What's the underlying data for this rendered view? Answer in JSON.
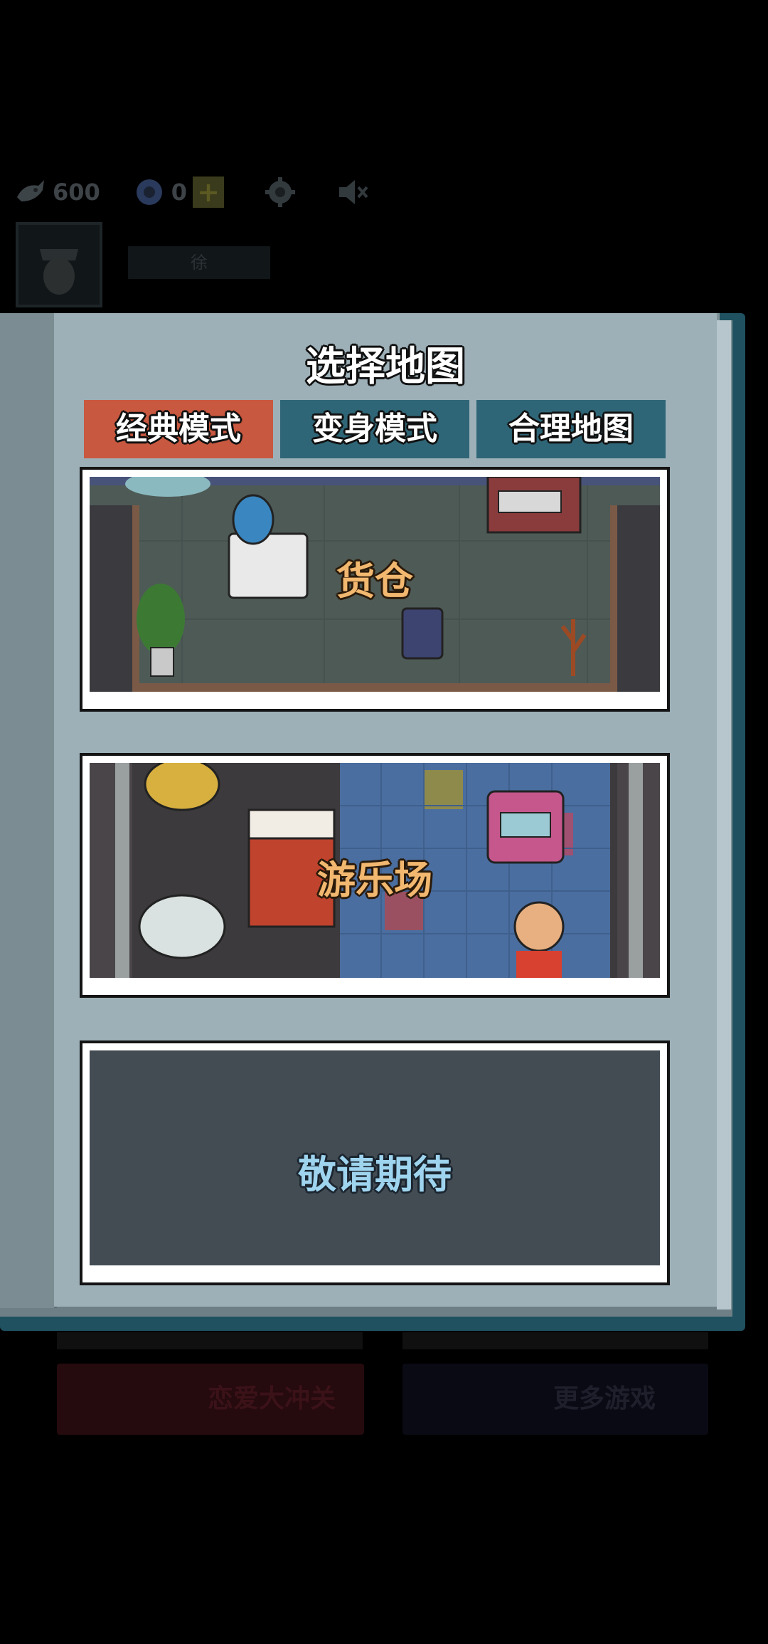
{
  "background": {
    "coins": "600",
    "tickets": "0",
    "plus": "+",
    "player_name": "徐",
    "bottom_left_button": "恋爱大冲关",
    "bottom_right_button": "更多游戏",
    "icons": [
      "fish-coin-icon",
      "ticket-icon",
      "plus-icon",
      "gear-icon",
      "speaker-muted-icon",
      "avatar-icon"
    ]
  },
  "dialog": {
    "title": "选择地图",
    "tabs": [
      {
        "label": "经典模式",
        "active": true
      },
      {
        "label": "变身模式",
        "active": false
      },
      {
        "label": "合理地图",
        "active": false
      }
    ],
    "maps": [
      {
        "name": "货仓"
      },
      {
        "name": "游乐场"
      },
      {
        "name": "敬请期待"
      }
    ]
  },
  "colors": {
    "tab_active": "#c8583f",
    "tab_inactive": "#2f6677",
    "map_label": "#f2b870",
    "coming_soon_label": "#9fd4ef",
    "page": "#9db0b8"
  }
}
